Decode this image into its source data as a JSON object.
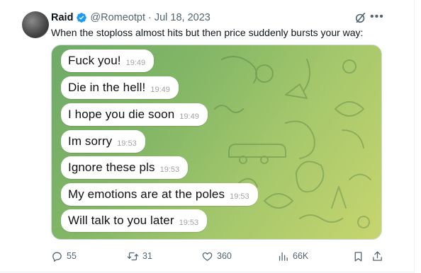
{
  "author": {
    "display_name": "Raid",
    "handle": "@Romeotpt",
    "separator": "·",
    "date": "Jul 18, 2023"
  },
  "tweet": {
    "text": "When the stoploss almost hits but then price suddenly bursts your way:"
  },
  "chat": {
    "messages": [
      {
        "text": "Fuck you!",
        "time": "19:49"
      },
      {
        "text": "Die in the hell!",
        "time": "19:49"
      },
      {
        "text": "I hope you die soon",
        "time": "19:49"
      },
      {
        "text": "Im sorry",
        "time": "19:53"
      },
      {
        "text": "Ignore these pls",
        "time": "19:53"
      },
      {
        "text": "My emotions are at the poles",
        "time": "19:53"
      },
      {
        "text": "Will talk to you later",
        "time": "19:53"
      }
    ]
  },
  "actions": {
    "replies": "55",
    "reposts": "31",
    "likes": "360",
    "views": "66K"
  },
  "icons": {
    "verified": "verified-badge-icon",
    "grok": "grok-icon",
    "more": "more-icon",
    "reply": "reply-icon",
    "repost": "repost-icon",
    "like": "heart-icon",
    "views": "views-icon",
    "bookmark": "bookmark-icon",
    "share": "share-icon"
  },
  "colors": {
    "verified_blue": "#1d9bf0",
    "secondary_text": "#536471",
    "chat_gradient_start": "#6faa68",
    "chat_gradient_end": "#c7d56f"
  }
}
